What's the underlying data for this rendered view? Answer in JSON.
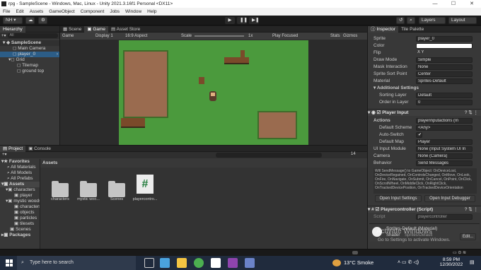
{
  "window": {
    "title": "rpg - SampleScene - Windows, Mac, Linux - Unity 2021.3.16f1 Personal <DX11>",
    "min": "—",
    "max": "☐",
    "close": "✕"
  },
  "menu": [
    "File",
    "Edit",
    "Assets",
    "GameObject",
    "Component",
    "Jobs",
    "Window",
    "Help"
  ],
  "toolbar": {
    "account": "NH ▾",
    "layers": "Layers",
    "layout": "Layout"
  },
  "hierarchy": {
    "tab": "Hierarchy",
    "search": "All",
    "items": [
      "SampleScene",
      "Main Camera",
      "player_0",
      "Grid",
      "Tilemap",
      "ground top"
    ]
  },
  "scene_tabs": [
    "Scene",
    "Game",
    "Asset Store"
  ],
  "game_bar": {
    "mode": "Game",
    "display": "Display 1",
    "aspect": "16:9 Aspect",
    "scale_label": "Scale",
    "scale_value": "1x",
    "play_focused": "Play Focused",
    "stats": "Stats",
    "gizmos": "Gizmos"
  },
  "project": {
    "tabs": [
      "Project",
      "Console"
    ],
    "tree": [
      {
        "label": "Favorites",
        "bold": true
      },
      {
        "label": "All Materials"
      },
      {
        "label": "All Models"
      },
      {
        "label": "All Prefabs"
      },
      {
        "label": "Assets",
        "bold": true
      },
      {
        "label": "characters"
      },
      {
        "label": "player"
      },
      {
        "label": "mystic woods"
      },
      {
        "label": "characters"
      },
      {
        "label": "objects"
      },
      {
        "label": "particles"
      },
      {
        "label": "tilesets"
      },
      {
        "label": "Scenes"
      },
      {
        "label": "Packages",
        "bold": true
      }
    ],
    "breadcrumb": "Assets",
    "items": [
      "characters",
      "mystic woo...",
      "Scenes",
      "playercontro..."
    ],
    "count": "14"
  },
  "inspector": {
    "tabs": [
      "Inspector",
      "Tile Palette"
    ],
    "sprite_renderer": [
      {
        "label": "Sprite",
        "value": "player_0"
      },
      {
        "label": "Color",
        "value": ""
      },
      {
        "label": "Flip",
        "value": "X   Y"
      },
      {
        "label": "Draw Mode",
        "value": "Simple"
      },
      {
        "label": "Mask Interaction",
        "value": "None"
      },
      {
        "label": "Sprite Sort Point",
        "value": "Center"
      },
      {
        "label": "Material",
        "value": "Sprites-Default"
      }
    ],
    "additional": "Additional Settings",
    "sorting": [
      {
        "label": "Sorting Layer",
        "value": "Default"
      },
      {
        "label": "Order in Layer",
        "value": "0"
      }
    ],
    "player_input": {
      "title": "Player Input",
      "actions_label": "Actions",
      "actions_value": "playerinputactions (In",
      "rows": [
        {
          "label": "Default Scheme",
          "value": "<Any>"
        },
        {
          "label": "Auto-Switch",
          "value": "✔"
        },
        {
          "label": "Default Map",
          "value": "Player"
        },
        {
          "label": "UI Input Module",
          "value": "None (Input System UI In"
        },
        {
          "label": "Camera",
          "value": "None (Camera)"
        },
        {
          "label": "Behavior",
          "value": "Send Messages"
        }
      ],
      "info": "Will SendMessage() to GameObject: OnDeviceLost, OnDeviceRegained, OnControlsChanged, OnMove, OnLook, OnFire, OnNavigate, OnSubmit, OnCancel, OnPoint, OnClick, OnScrollWheel, OnMiddleClick, OnRightClick, OnTrackedDevicePosition, OnTrackedDeviceOrientation",
      "btn1": "Open Input Settings",
      "btn2": "Open Input Debugger"
    },
    "script": {
      "title": "Playercontroller (Script)",
      "label": "Script",
      "value": "playercontroller"
    },
    "material": {
      "name": "Sprites-Default (Material)",
      "shader_label": "Shader",
      "shader": "Sprites/Default",
      "edit": "Edit..."
    }
  },
  "watermark": {
    "line1": "Activate Windows",
    "line2": "Go to Settings to activate Windows."
  },
  "taskbar": {
    "search": "Type here to search",
    "weather": "13°C  Smoke",
    "time": "8:59 PM",
    "date": "12/30/2022"
  }
}
